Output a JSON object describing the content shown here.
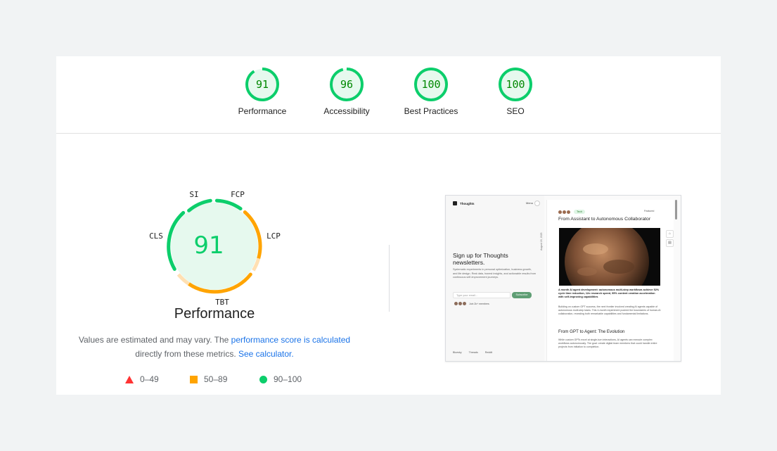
{
  "categories": [
    {
      "id": "performance",
      "label": "Performance",
      "score": 91
    },
    {
      "id": "accessibility",
      "label": "Accessibility",
      "score": 96
    },
    {
      "id": "best-practices",
      "label": "Best Practices",
      "score": 100
    },
    {
      "id": "seo",
      "label": "SEO",
      "score": 100
    }
  ],
  "performance": {
    "score": 91,
    "title": "Performance",
    "metrics": [
      "SI",
      "FCP",
      "LCP",
      "TBT",
      "CLS"
    ],
    "note_prefix": "Values are estimated and may vary. The ",
    "note_link1": "performance score is calculated",
    "note_middle": " directly from these metrics. ",
    "note_link2": "See calculator.",
    "legend": [
      {
        "shape": "triangle",
        "color": "#ff3333",
        "range": "0–49"
      },
      {
        "shape": "square",
        "color": "#ffa400",
        "range": "50–89"
      },
      {
        "shape": "circle",
        "color": "#0cce6b",
        "range": "90–100"
      }
    ]
  },
  "colors": {
    "good": "#0cce6b",
    "average": "#ffa400",
    "poor": "#ff3333",
    "link": "#1a73e8"
  },
  "thumbnail": {
    "brand": "Thoughts",
    "menu": "Menu",
    "signup_heading": "Sign up for Thoughts newsletters.",
    "signup_sub": "Systematic experiments in personal optimization, business growth, and life design. Real data, honest insights, and actionable results from continuous self-improvement journeys.",
    "email_placeholder": "Type your email...",
    "subscribe": "Subscribe",
    "join": "Join 2k+ members",
    "footer_links": [
      "Bluesky",
      "Threads",
      "Reddit"
    ],
    "vertical_date": "August 20, 2025",
    "tag": "Tech",
    "featured": "Featured",
    "post_title": "From Assistant to Autonomous Collaborator",
    "post_summary": "A month AI agent development: autonomous multi-step workflows achieve 52% cycle time reduction, 12x research speed, 95% content creation acceleration with self-improving capabilities",
    "post_body": "Building on custom GPT success, the next frontier involved creating AI agents capable of autonomous multi-step tasks. This 4-month experiment pushed the boundaries of human-AI collaboration, revealing both remarkable capabilities and fundamental limitations.",
    "section_title": "From GPT to Agent: The Evolution",
    "section_body": "While custom GPTs excel at single-turn interactions, AI agents can execute complex workflows autonomously. The goal: create digital team members that could handle entire projects from initiation to completion."
  }
}
